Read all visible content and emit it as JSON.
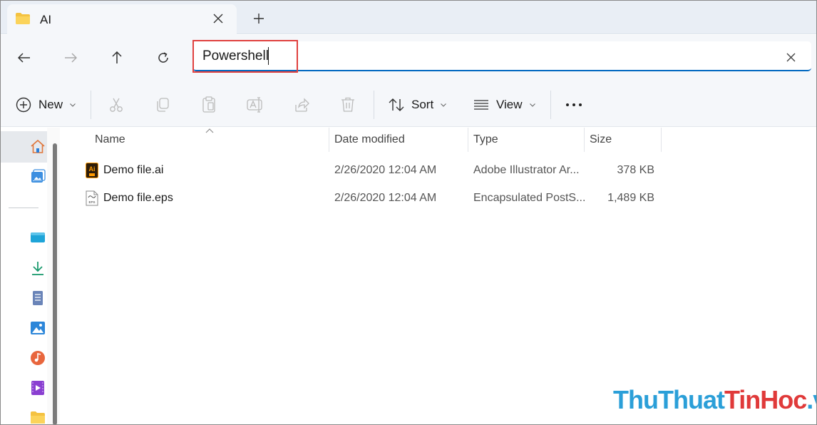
{
  "tab": {
    "title": "AI"
  },
  "address": {
    "value": "Powershell"
  },
  "toolbar": {
    "new_label": "New",
    "sort_label": "Sort",
    "view_label": "View",
    "more_label": "···"
  },
  "columns": {
    "name": "Name",
    "date": "Date modified",
    "type": "Type",
    "size": "Size"
  },
  "files": [
    {
      "name": "Demo file.ai",
      "date": "2/26/2020 12:04 AM",
      "type": "Adobe Illustrator Ar...",
      "size": "378 KB",
      "icon": "illustrator-file-icon"
    },
    {
      "name": "Demo file.eps",
      "date": "2/26/2020 12:04 AM",
      "type": "Encapsulated PostS...",
      "size": "1,489 KB",
      "icon": "eps-file-icon"
    }
  ],
  "file_icon_labels": {
    "ai": "Ai",
    "eps": "EPS"
  },
  "watermark": {
    "part1": "ThuThuat",
    "part2": "TinHoc",
    "part3": ".vn"
  },
  "colors": {
    "accent": "#0067c0",
    "highlight": "#e0413f"
  }
}
